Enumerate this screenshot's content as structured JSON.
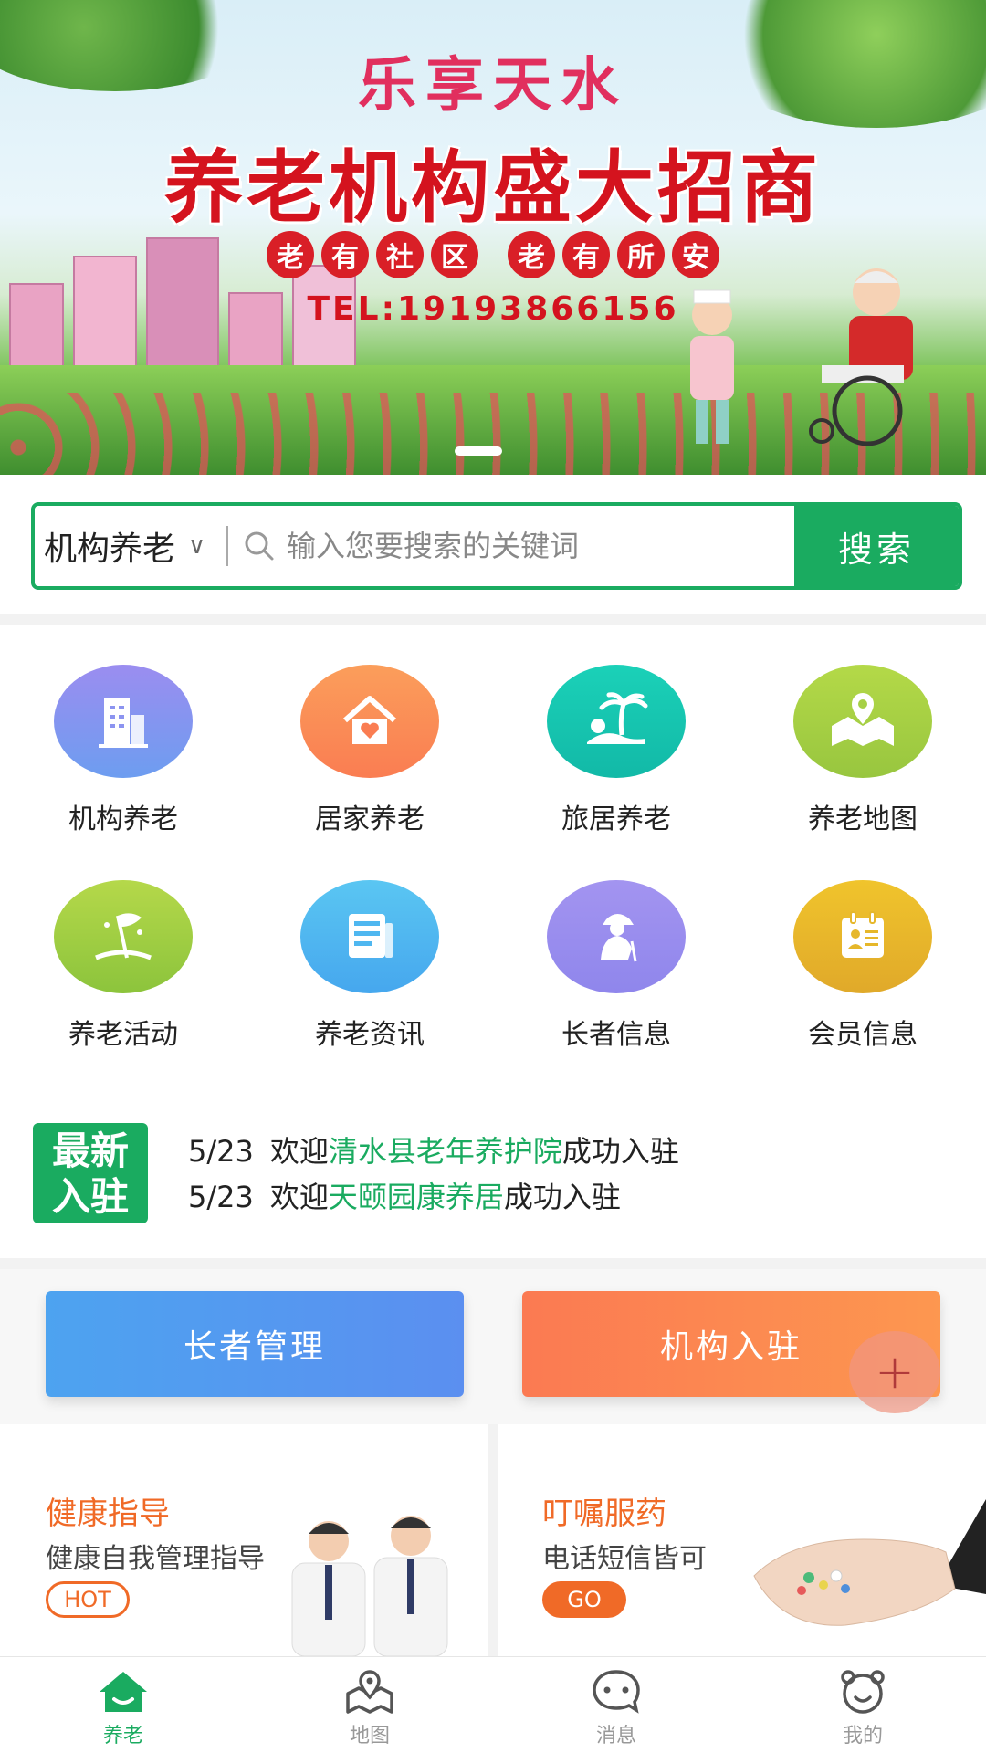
{
  "banner": {
    "title_line1": "乐享天水",
    "title_line2": "养老机构盛大招商",
    "tags_group1": [
      "老",
      "有",
      "社",
      "区"
    ],
    "tags_group2": [
      "老",
      "有",
      "所",
      "安"
    ],
    "tel": "TEL:19193866156"
  },
  "search": {
    "category": "机构养老",
    "placeholder": "输入您要搜索的关键词",
    "button": "搜索"
  },
  "services": [
    {
      "label": "机构养老",
      "icon": "building-icon",
      "color": "#8c94f0"
    },
    {
      "label": "居家养老",
      "icon": "home-heart-icon",
      "color": "#fb8c52"
    },
    {
      "label": "旅居养老",
      "icon": "palm-island-icon",
      "color": "#18c9b2"
    },
    {
      "label": "养老地图",
      "icon": "map-pin-icon",
      "color": "#a6d046"
    },
    {
      "label": "养老活动",
      "icon": "flag-icon",
      "color": "#9fcf3f"
    },
    {
      "label": "养老资讯",
      "icon": "newspaper-icon",
      "color": "#4fb7f0"
    },
    {
      "label": "长者信息",
      "icon": "elder-icon",
      "color": "#9a8eee"
    },
    {
      "label": "会员信息",
      "icon": "member-card-icon",
      "color": "#e6b72a"
    }
  ],
  "news": {
    "badge_line1": "最新",
    "badge_line2": "入驻",
    "items": [
      {
        "date": "5/23",
        "prefix": "欢迎",
        "name": "清水县老年养护院",
        "suffix": "成功入驻"
      },
      {
        "date": "5/23",
        "prefix": "欢迎",
        "name": "天颐园康养居",
        "suffix": "成功入驻"
      }
    ]
  },
  "actions": {
    "elder_manage": "长者管理",
    "org_join": "机构入驻",
    "fab": "+"
  },
  "cards": {
    "health": {
      "title": "健康指导",
      "subtitle": "健康自我管理指导",
      "badge": "HOT"
    },
    "medicine": {
      "title": "叮嘱服药",
      "subtitle": "电话短信皆可",
      "badge": "GO"
    }
  },
  "tabbar": {
    "items": [
      {
        "label": "养老",
        "icon": "home-icon",
        "active": true
      },
      {
        "label": "地图",
        "icon": "map-icon",
        "active": false
      },
      {
        "label": "消息",
        "icon": "message-icon",
        "active": false
      },
      {
        "label": "我的",
        "icon": "profile-icon",
        "active": false
      }
    ]
  },
  "colors": {
    "brand_green": "#1aab60",
    "accent_orange": "#f06a27",
    "banner_red": "#d4131e"
  }
}
